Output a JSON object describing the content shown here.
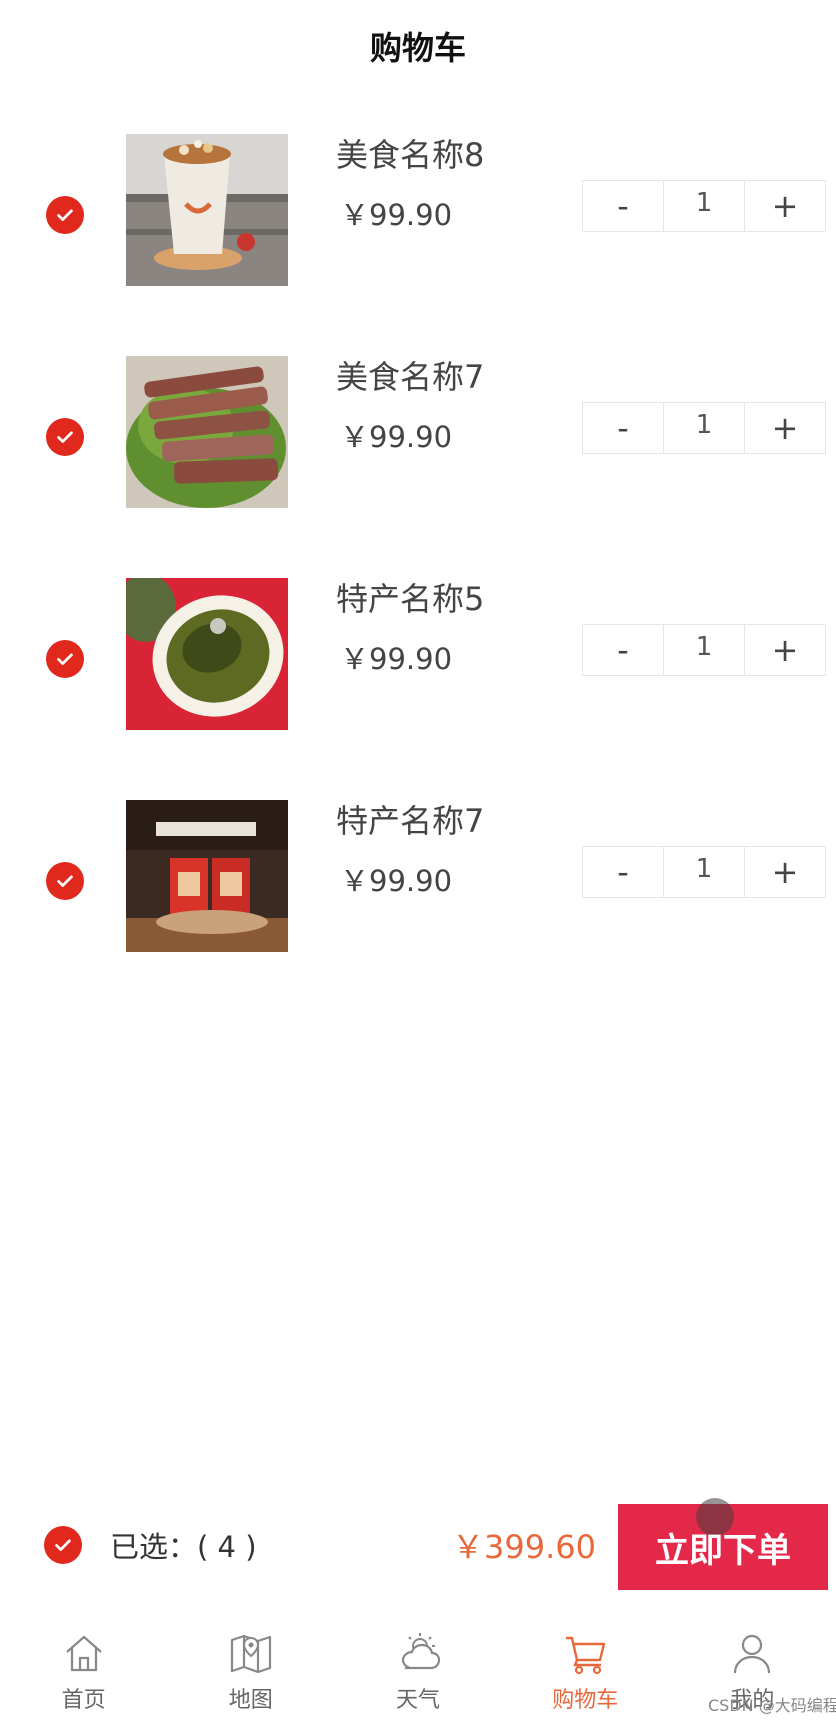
{
  "header": {
    "title": "购物车"
  },
  "cart_items": [
    {
      "name": "美食名称8",
      "price": "￥99.90",
      "quantity": "1",
      "minus": "-",
      "plus": "+",
      "checked": true
    },
    {
      "name": "美食名称7",
      "price": "￥99.90",
      "quantity": "1",
      "minus": "-",
      "plus": "+",
      "checked": true
    },
    {
      "name": "特产名称5",
      "price": "￥99.90",
      "quantity": "1",
      "minus": "-",
      "plus": "+",
      "checked": true
    },
    {
      "name": "特产名称7",
      "price": "￥99.90",
      "quantity": "1",
      "minus": "-",
      "plus": "+",
      "checked": true
    }
  ],
  "footer": {
    "selected_label": "已选：( 4 )",
    "total": "￥399.60",
    "order_button": "立即下单",
    "all_checked": true
  },
  "tabbar": [
    {
      "label": "首页",
      "icon": "home-icon",
      "active": false
    },
    {
      "label": "地图",
      "icon": "map-icon",
      "active": false
    },
    {
      "label": "天气",
      "icon": "weather-icon",
      "active": false
    },
    {
      "label": "购物车",
      "icon": "cart-icon",
      "active": true
    },
    {
      "label": "我的",
      "icon": "user-icon",
      "active": false
    }
  ],
  "watermark": "CSDN @大码编程",
  "colors": {
    "accent": "#e0281c",
    "price_total": "#e8683c",
    "order_button": "#e4284a",
    "tab_active": "#e8683c"
  }
}
